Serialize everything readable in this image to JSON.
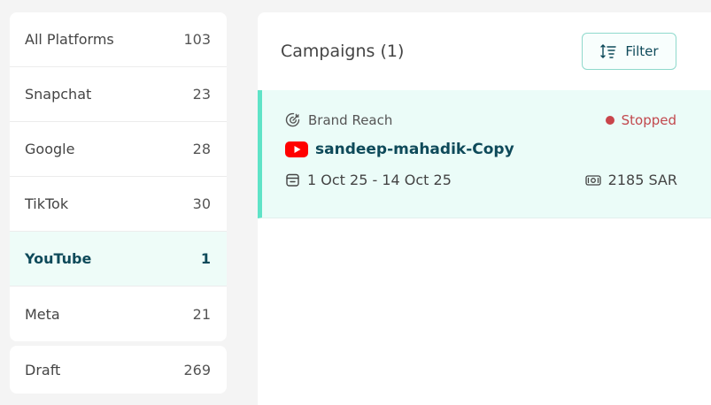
{
  "sidebar": {
    "platforms": [
      {
        "label": "All Platforms",
        "count": "103"
      },
      {
        "label": "Snapchat",
        "count": "23"
      },
      {
        "label": "Google",
        "count": "28"
      },
      {
        "label": "TikTok",
        "count": "30"
      },
      {
        "label": "YouTube",
        "count": "1"
      },
      {
        "label": "Meta",
        "count": "21"
      }
    ],
    "draft": {
      "label": "Draft",
      "count": "269"
    }
  },
  "main": {
    "title": "Campaigns (1)",
    "filter_label": "Filter",
    "campaigns": [
      {
        "objective": "Brand Reach",
        "status": "Stopped",
        "name": "sandeep-mahadik-Copy",
        "date_range": "1 Oct 25 - 14 Oct 25",
        "budget": "2185 SAR",
        "platform_icon": "youtube-icon"
      }
    ]
  },
  "colors": {
    "accent": "#5fe3c7",
    "active_bg": "#eefcf8",
    "brand_text": "#0e4a5a",
    "status_stopped": "#c9454b",
    "youtube_red": "#ff0000"
  }
}
